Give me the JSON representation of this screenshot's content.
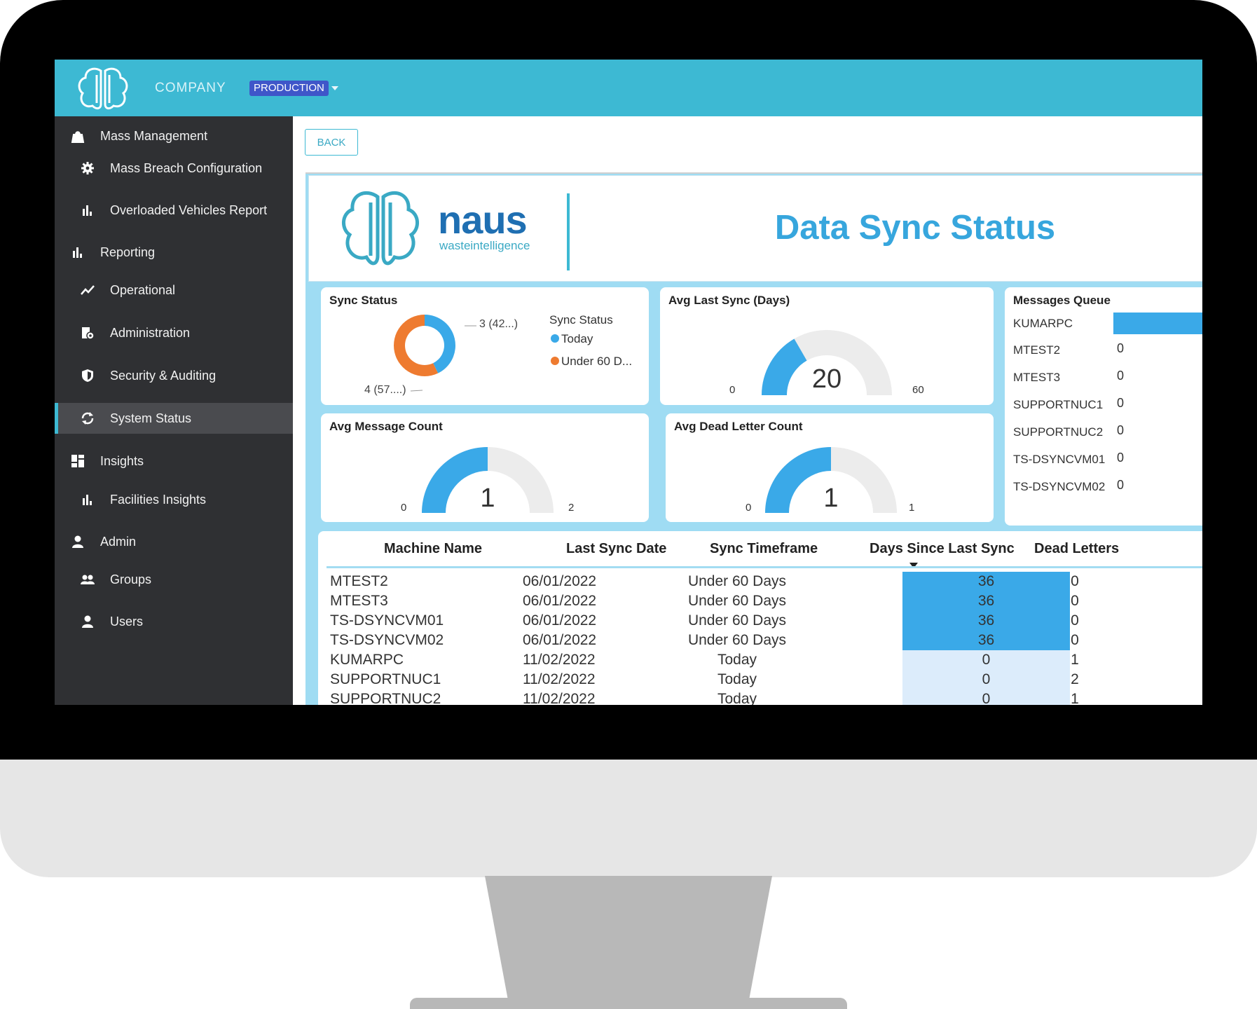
{
  "topbar": {
    "company": "COMPANY",
    "environment": "PRODUCTION",
    "accent": "#3db9d3"
  },
  "sidebar": {
    "items": [
      {
        "label": "Mass Management",
        "icon": "bag-icon",
        "level": "top"
      },
      {
        "label": "Mass Breach Configuration",
        "icon": "gear-icon",
        "level": "sub"
      },
      {
        "label": "Overloaded Vehicles Report",
        "icon": "bar-chart-icon",
        "level": "sub"
      },
      {
        "label": "Reporting",
        "icon": "bar-chart-icon",
        "level": "top"
      },
      {
        "label": "Operational",
        "icon": "trend-line-icon",
        "level": "sub"
      },
      {
        "label": "Administration",
        "icon": "admin-icon",
        "level": "sub"
      },
      {
        "label": "Security & Auditing",
        "icon": "shield-icon",
        "level": "sub"
      },
      {
        "label": "System Status",
        "icon": "sync-icon",
        "level": "sub",
        "active": true
      },
      {
        "label": "Insights",
        "icon": "dashboard-icon",
        "level": "top"
      },
      {
        "label": "Facilities Insights",
        "icon": "bar-chart-icon",
        "level": "sub"
      },
      {
        "label": "Admin",
        "icon": "person-icon",
        "level": "top"
      },
      {
        "label": "Groups",
        "icon": "group-icon",
        "level": "sub"
      },
      {
        "label": "Users",
        "icon": "person-icon",
        "level": "sub"
      }
    ]
  },
  "content": {
    "back_label": "BACK",
    "logo_word": "naus",
    "logo_tag": "wasteintelligence",
    "title": "Data Sync Status"
  },
  "cards": {
    "sync_status": {
      "title": "Sync Status",
      "legend_title": "Sync Status",
      "slices": [
        {
          "name": "Today",
          "value": 3,
          "label": "3 (42...)",
          "color": "#3aa9e8"
        },
        {
          "name": "Under 60 D...",
          "value": 4,
          "label": "4 (57....)",
          "color": "#ee7b30"
        }
      ]
    },
    "avg_last_sync": {
      "title": "Avg Last Sync (Days)",
      "min": "0",
      "max": "60",
      "value": "20",
      "fraction": 0.3333
    },
    "avg_message_count": {
      "title": "Avg Message Count",
      "min": "0",
      "max": "2",
      "value": "1",
      "fraction": 0.5
    },
    "avg_dead_letter_count": {
      "title": "Avg Dead Letter Count",
      "min": "0",
      "max": "1",
      "value": "1",
      "fraction": 0.5
    },
    "messages_queue": {
      "title": "Messages Queue",
      "rows": [
        {
          "name": "KUMARPC",
          "value": "",
          "bar": true
        },
        {
          "name": "MTEST2",
          "value": "0"
        },
        {
          "name": "MTEST3",
          "value": "0"
        },
        {
          "name": "SUPPORTNUC1",
          "value": "0"
        },
        {
          "name": "SUPPORTNUC2",
          "value": "0"
        },
        {
          "name": "TS-DSYNCVM01",
          "value": "0"
        },
        {
          "name": "TS-DSYNCVM02",
          "value": "0"
        }
      ]
    }
  },
  "table": {
    "columns": [
      "Machine Name",
      "Last Sync Date",
      "Sync Timeframe",
      "Days Since Last Sync",
      "Dead Letters"
    ],
    "rows": [
      {
        "machine": "MTEST2",
        "date": "06/01/2022",
        "timeframe": "Under 60 Days",
        "days": "36",
        "dead": "0",
        "highlight": "strong"
      },
      {
        "machine": "MTEST3",
        "date": "06/01/2022",
        "timeframe": "Under 60 Days",
        "days": "36",
        "dead": "0",
        "highlight": "strong"
      },
      {
        "machine": "TS-DSYNCVM01",
        "date": "06/01/2022",
        "timeframe": "Under 60 Days",
        "days": "36",
        "dead": "0",
        "highlight": "strong"
      },
      {
        "machine": "TS-DSYNCVM02",
        "date": "06/01/2022",
        "timeframe": "Under 60 Days",
        "days": "36",
        "dead": "0",
        "highlight": "strong"
      },
      {
        "machine": "KUMARPC",
        "date": "11/02/2022",
        "timeframe": "Today",
        "days": "0",
        "dead": "1",
        "highlight": "light"
      },
      {
        "machine": "SUPPORTNUC1",
        "date": "11/02/2022",
        "timeframe": "Today",
        "days": "0",
        "dead": "2",
        "highlight": "light"
      },
      {
        "machine": "SUPPORTNUC2",
        "date": "11/02/2022",
        "timeframe": "Today",
        "days": "0",
        "dead": "1",
        "highlight": "light"
      }
    ]
  }
}
